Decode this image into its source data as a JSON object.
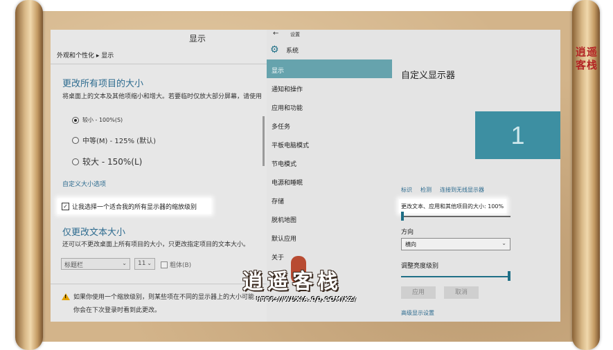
{
  "colors": {
    "accent": "#2d6b8f",
    "nav_active": "#66a3ad",
    "monitor": "#3d8fa2",
    "warning": "#e5a300"
  },
  "seal_text": "逍遥客栈",
  "left_window": {
    "title": "显示",
    "breadcrumb": "外观和个性化 ▸ 显示",
    "size_heading": "更改所有项目的大小",
    "size_desc": "将桌面上的文本及其他项缩小和增大。若要临时仅放大部分屏幕，请使用",
    "options": [
      {
        "label": "较小 - 100%(S)",
        "selected": true
      },
      {
        "label": "中等(M) - 125% (默认)",
        "selected": false
      },
      {
        "label": "较大 - 150%(L)",
        "selected": false
      }
    ],
    "custom_size_link": "自定义大小选项",
    "scale_checkbox_label": "让我选择一个适合我的所有显示器的缩放级别",
    "scale_checkbox_checked": true,
    "text_heading": "仅更改文本大小",
    "text_desc": "还可以不更改桌面上所有项目的大小，只更改指定项目的文本大小。",
    "item_select": "标题栏",
    "font_size_select": "11",
    "bold_label": "粗体(B)",
    "warning_line1": "如果你使用一个缩放级别，则某些项在不同的显示器上的大小可能",
    "warning_line2": "你会在下次登录时看到此更改。"
  },
  "right_window": {
    "back_icon": "←",
    "settings_label": "设置",
    "system_label": "系统",
    "nav_items": [
      "显示",
      "通知和操作",
      "应用和功能",
      "多任务",
      "平板电脑模式",
      "节电模式",
      "电源和睡眠",
      "存储",
      "脱机地图",
      "默认应用",
      "关于"
    ],
    "active_nav_index": 0,
    "panel_title": "自定义显示器",
    "monitor_number": "1",
    "monitor_links": [
      "标识",
      "检测",
      "连接到无线显示器"
    ],
    "size_label": "更改文本、应用和其他项目的大小: 100%",
    "size_slider_value": 0,
    "orientation_label": "方向",
    "orientation_value": "横向",
    "brightness_label": "调整亮度级别",
    "brightness_value": 1,
    "apply_button": "应用",
    "cancel_button": "取消",
    "advanced_link": "高级显示设置"
  },
  "watermark": {
    "title": "逍遥客栈",
    "url": "HTTP://WUXIA.QQ.COM/KZ/"
  }
}
